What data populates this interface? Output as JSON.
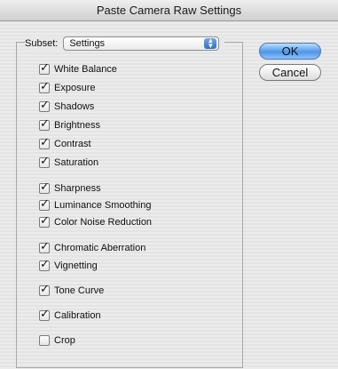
{
  "window": {
    "title": "Paste Camera Raw Settings"
  },
  "subset": {
    "label": "Subset:",
    "value": "Settings"
  },
  "buttons": {
    "ok": "OK",
    "cancel": "Cancel"
  },
  "options": [
    {
      "label": "White Balance",
      "checked": true
    },
    {
      "label": "Exposure",
      "checked": true
    },
    {
      "label": "Shadows",
      "checked": true
    },
    {
      "label": "Brightness",
      "checked": true
    },
    {
      "label": "Contrast",
      "checked": true
    },
    {
      "label": "Saturation",
      "checked": true
    },
    {
      "label": "Sharpness",
      "checked": true
    },
    {
      "label": "Luminance Smoothing",
      "checked": true
    },
    {
      "label": "Color Noise Reduction",
      "checked": true
    },
    {
      "label": "Chromatic Aberration",
      "checked": true
    },
    {
      "label": "Vignetting",
      "checked": true
    },
    {
      "label": "Tone Curve",
      "checked": true
    },
    {
      "label": "Calibration",
      "checked": true
    },
    {
      "label": "Crop",
      "checked": false
    }
  ],
  "colors": {
    "ok_button": "#4b95e6",
    "window_bg": "#e6e6e6"
  }
}
